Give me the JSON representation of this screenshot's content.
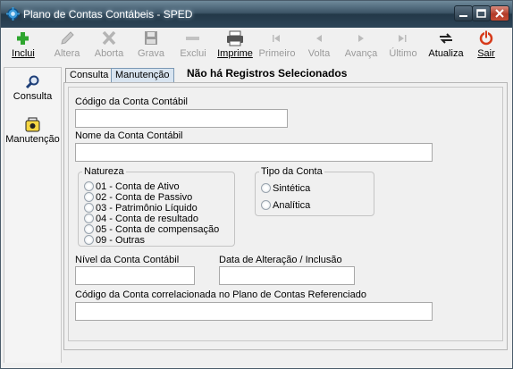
{
  "window": {
    "title": "Plano de Contas Contábeis - SPED"
  },
  "toolbar": {
    "buttons": [
      {
        "label": "Inclui",
        "icon": "plus-icon",
        "enabled": true
      },
      {
        "label": "Altera",
        "icon": "pencil-icon",
        "enabled": false
      },
      {
        "label": "Aborta",
        "icon": "cross-icon",
        "enabled": false
      },
      {
        "label": "Grava",
        "icon": "floppy-disk-icon",
        "enabled": false
      },
      {
        "label": "Exclui",
        "icon": "minus-icon",
        "enabled": false
      },
      {
        "label": "Imprime",
        "icon": "printer-icon",
        "enabled": true
      },
      {
        "label": "Primeiro",
        "icon": "first-record-icon",
        "enabled": false
      },
      {
        "label": "Volta",
        "icon": "previous-record-icon",
        "enabled": false
      },
      {
        "label": "Avança",
        "icon": "next-record-icon",
        "enabled": false
      },
      {
        "label": "Último",
        "icon": "last-record-icon",
        "enabled": false
      },
      {
        "label": "Atualiza",
        "icon": "refresh-icon",
        "enabled": true
      },
      {
        "label": "Sair",
        "icon": "power-icon",
        "enabled": true
      }
    ]
  },
  "leftpanel": {
    "items": [
      {
        "label": "Consulta",
        "icon": "magnifier-icon"
      },
      {
        "label": "Manutenção",
        "icon": "maintenance-icon"
      }
    ]
  },
  "tabs": [
    {
      "label": "Consulta",
      "active": false
    },
    {
      "label": "Manutenção",
      "active": true
    }
  ],
  "status": {
    "message": "Não há Registros Selecionados"
  },
  "form": {
    "codigo_label": "Código da Conta Contábil",
    "codigo_value": "",
    "nome_label": "Nome da Conta Contábil",
    "nome_value": "",
    "natureza": {
      "title": "Natureza",
      "options": [
        "01 - Conta de Ativo",
        "02 - Conta de Passivo",
        "03 - Patrimônio Líquido",
        "04 - Conta de resultado",
        "05 - Conta de compensação",
        "09 - Outras"
      ]
    },
    "tipo": {
      "title": "Tipo da Conta",
      "options": [
        "Sintética",
        "Analítica"
      ]
    },
    "nivel_label": "Nível da Conta Contábil",
    "nivel_value": "",
    "data_label": "Data de Alteração / Inclusão",
    "data_value": "",
    "referenciada_label": "Código da Conta correlacionada no Plano de Contas Referenciado",
    "referenciada_value": ""
  }
}
